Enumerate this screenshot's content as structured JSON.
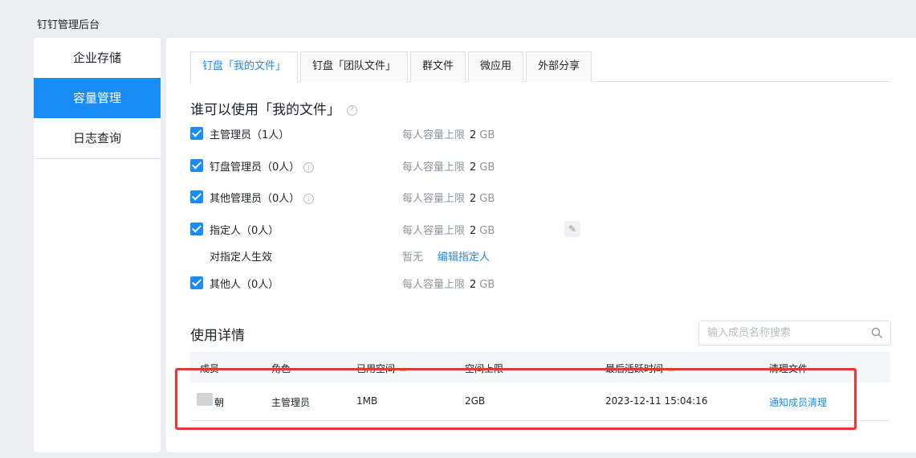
{
  "app": {
    "title": "钉钉管理后台"
  },
  "sidebar": {
    "items": [
      {
        "label": "企业存储",
        "active": false
      },
      {
        "label": "容量管理",
        "active": true
      },
      {
        "label": "日志查询",
        "active": false
      }
    ]
  },
  "tabs": [
    {
      "label": "钉盘「我的文件」",
      "active": true
    },
    {
      "label": "钉盘「团队文件」",
      "active": false
    },
    {
      "label": "群文件",
      "active": false
    },
    {
      "label": "微应用",
      "active": false
    },
    {
      "label": "外部分享",
      "active": false
    }
  ],
  "permissions": {
    "title": "谁可以使用「我的文件」",
    "quota_prefix": "每人容量上限",
    "quota_unit": "GB",
    "rows": [
      {
        "label": "主管理员（1人）",
        "quota": "2",
        "checked": true
      },
      {
        "label": "钉盘管理员（0人）",
        "quota": "2",
        "checked": true
      },
      {
        "label": "其他管理员（0人）",
        "quota": "2",
        "checked": true
      },
      {
        "label": "指定人（0人）",
        "quota": "2",
        "checked": true
      },
      {
        "label": "其他人（0人）",
        "quota": "2",
        "checked": true
      }
    ],
    "designated": {
      "label": "对指定人生效",
      "value": "暂无",
      "link": "编辑指定人"
    }
  },
  "usage": {
    "title": "使用详情",
    "search_placeholder": "输入成员名称搜索",
    "columns": [
      "成员",
      "角色",
      "已用空间",
      "空间上限",
      "最后活跃时间",
      "清理文件"
    ],
    "rows": [
      {
        "member": "朝",
        "role": "主管理员",
        "used": "1MB",
        "limit": "2GB",
        "last_active": "2023-12-11 15:04:16",
        "action": "通知成员清理"
      }
    ]
  },
  "colors": {
    "accent": "#1a8cf5",
    "highlight": "#e53935"
  }
}
